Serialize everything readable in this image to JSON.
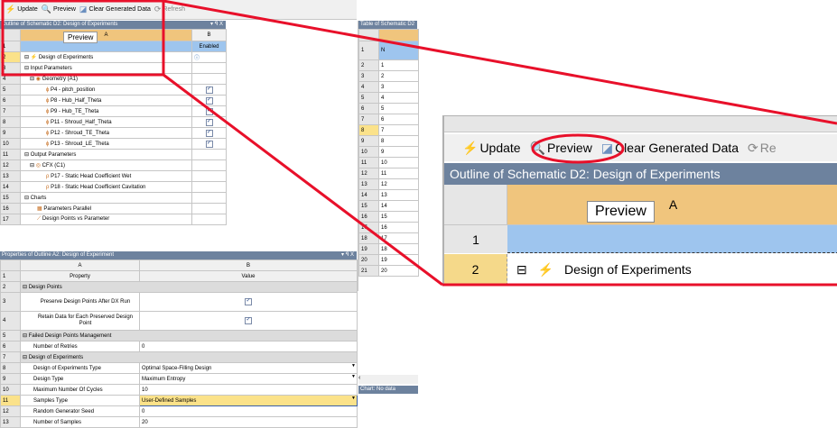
{
  "toolbar": {
    "update": "Update",
    "preview": "Preview",
    "clear": "Clear Generated Data",
    "refresh": "Refresh"
  },
  "outline": {
    "title": "Outline of Schematic D2: Design of Experiments",
    "col_a": "A",
    "col_b": "B",
    "enabled": "Enabled",
    "tooltip": "Preview",
    "rows": [
      {
        "n": "1",
        "label": "",
        "chk": false
      },
      {
        "n": "2",
        "label": "Design of Experiments",
        "chk": false
      },
      {
        "n": "3",
        "label": "Input Parameters",
        "chk": false
      },
      {
        "n": "4",
        "label": "Geometry (A1)",
        "chk": false
      },
      {
        "n": "5",
        "label": "P4 - pitch_position",
        "chk": true
      },
      {
        "n": "6",
        "label": "P8 - Hub_Half_Theta",
        "chk": true
      },
      {
        "n": "7",
        "label": "P9 - Hub_TE_Theta",
        "chk": true
      },
      {
        "n": "8",
        "label": "P11 - Shroud_Half_Theta",
        "chk": true
      },
      {
        "n": "9",
        "label": "P12 - Shroud_TE_Theta",
        "chk": true
      },
      {
        "n": "10",
        "label": "P13 - Shroud_LE_Theta",
        "chk": true
      },
      {
        "n": "11",
        "label": "Output Parameters",
        "chk": false
      },
      {
        "n": "12",
        "label": "CFX (C1)",
        "chk": false
      },
      {
        "n": "13",
        "label": "P17 - Static Head Coefficient Wet",
        "chk": false
      },
      {
        "n": "14",
        "label": "P18 - Static Head Coefficient Cavitation",
        "chk": false
      },
      {
        "n": "15",
        "label": "Charts",
        "chk": false
      },
      {
        "n": "16",
        "label": "Parameters Parallel",
        "chk": false
      },
      {
        "n": "17",
        "label": "Design Points vs Parameter",
        "chk": false
      }
    ]
  },
  "table": {
    "title": "Table of Schematic D2",
    "col_n": "N",
    "rows": [
      [
        "1",
        ""
      ],
      [
        "2",
        "1"
      ],
      [
        "3",
        "2"
      ],
      [
        "4",
        "3"
      ],
      [
        "5",
        "4"
      ],
      [
        "6",
        "5"
      ],
      [
        "7",
        "6"
      ],
      [
        "8",
        "7"
      ],
      [
        "9",
        "8"
      ],
      [
        "10",
        "9"
      ],
      [
        "11",
        "10"
      ],
      [
        "12",
        "11"
      ],
      [
        "13",
        "12"
      ],
      [
        "14",
        "13"
      ],
      [
        "15",
        "14"
      ],
      [
        "16",
        "15"
      ],
      [
        "17",
        "16"
      ],
      [
        "18",
        "17"
      ],
      [
        "19",
        "18"
      ],
      [
        "20",
        "19"
      ],
      [
        "21",
        "20"
      ]
    ]
  },
  "chart": {
    "title": "Chart: No data"
  },
  "props": {
    "title": "Properties of Outline A2: Design of Experiment",
    "col_a": "A",
    "col_b": "B",
    "rows": [
      {
        "n": "1",
        "a": "Property",
        "b": "Value",
        "kind": "head"
      },
      {
        "n": "2",
        "a": "Design Points",
        "b": "",
        "kind": "sect"
      },
      {
        "n": "3",
        "a": "Preserve Design Points After DX Run",
        "b": "",
        "kind": "chk"
      },
      {
        "n": "4",
        "a": "Retain Data for Each Preserved Design Point",
        "b": "",
        "kind": "chk"
      },
      {
        "n": "5",
        "a": "Failed Design Points Management",
        "b": "",
        "kind": "sect"
      },
      {
        "n": "6",
        "a": "Number of Retries",
        "b": "0",
        "kind": "val"
      },
      {
        "n": "7",
        "a": "Design of Experiments",
        "b": "",
        "kind": "sect"
      },
      {
        "n": "8",
        "a": "Design of Experiments Type",
        "b": "Optimal Space-Filling Design",
        "kind": "dd"
      },
      {
        "n": "9",
        "a": "Design Type",
        "b": "Maximum Entropy",
        "kind": "dd"
      },
      {
        "n": "10",
        "a": "Maximum Number Of Cycles",
        "b": "10",
        "kind": "val"
      },
      {
        "n": "11",
        "a": "Samples Type",
        "b": "User-Defined Samples",
        "kind": "ddsel"
      },
      {
        "n": "12",
        "a": "Random Generator Seed",
        "b": "0",
        "kind": "val"
      },
      {
        "n": "13",
        "a": "Number of Samples",
        "b": "20",
        "kind": "val"
      }
    ]
  },
  "zoom": {
    "update": "Update",
    "preview": "Preview",
    "clear": "Clear Generated Data",
    "refresh": "Re",
    "title": "Outline of Schematic D2: Design of Experiments",
    "tooltip": "Preview",
    "col_a": "A",
    "row1": "1",
    "row2": "2",
    "row2_label": "Design of Experiments"
  },
  "colors": {
    "accent": "#e8102a",
    "header": "#6d829e",
    "col_header": "#f0c57d"
  }
}
